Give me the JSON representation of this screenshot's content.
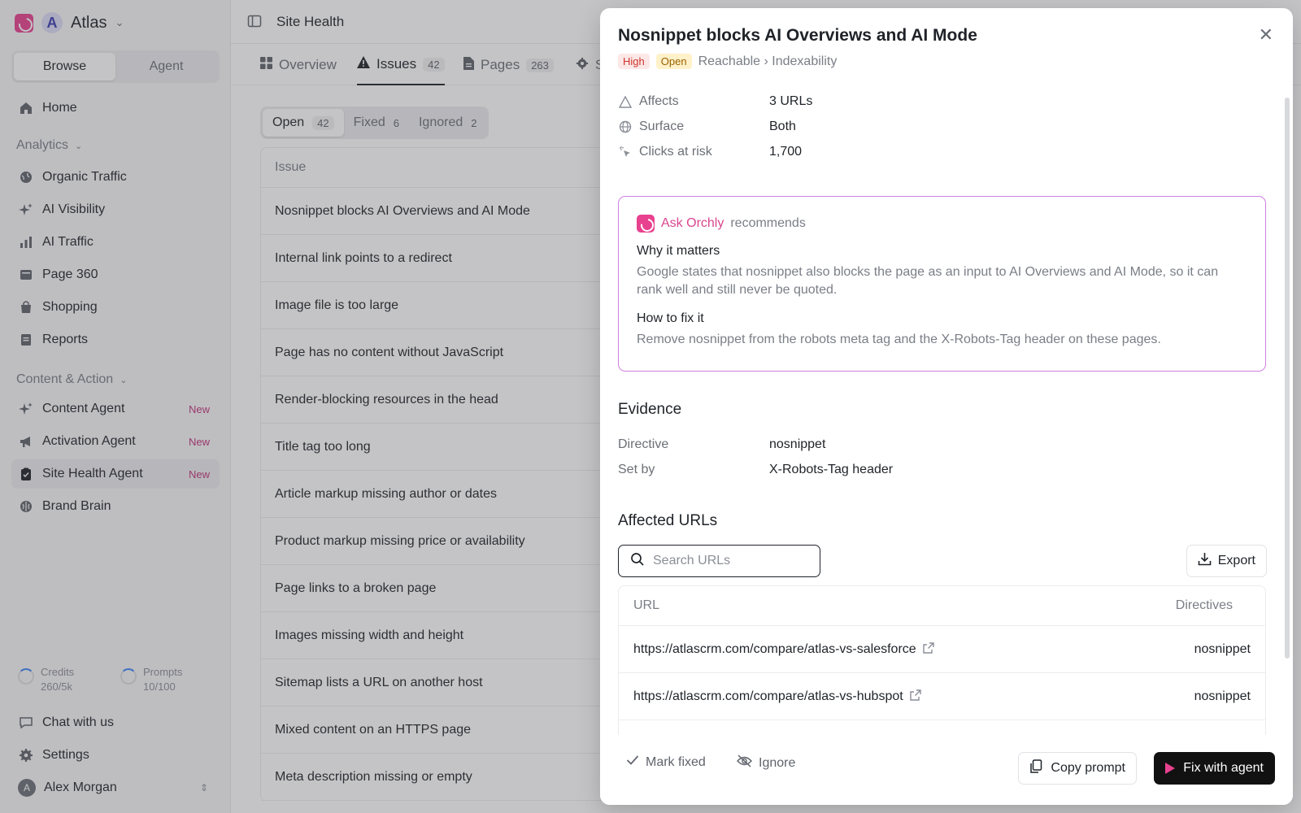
{
  "sidebar": {
    "workspace": {
      "initial": "A",
      "name": "Atlas"
    },
    "mode": {
      "browse": "Browse",
      "agent": "Agent"
    },
    "home": "Home",
    "analytics_label": "Analytics",
    "analytics": [
      "Organic Traffic",
      "AI Visibility",
      "AI Traffic",
      "Page 360",
      "Shopping",
      "Reports"
    ],
    "content_label": "Content & Action",
    "content": [
      {
        "label": "Content Agent",
        "badge": "New"
      },
      {
        "label": "Activation Agent",
        "badge": "New"
      },
      {
        "label": "Site Health Agent",
        "badge": "New"
      },
      {
        "label": "Brand Brain",
        "badge": ""
      }
    ],
    "credits": {
      "label": "Credits",
      "value": "260/5k"
    },
    "prompts": {
      "label": "Prompts",
      "value": "10/100"
    },
    "chat": "Chat with us",
    "settings": "Settings",
    "user": {
      "initial": "A",
      "name": "Alex Morgan"
    }
  },
  "main": {
    "title": "Site Health",
    "tabs": [
      {
        "label": "Overview",
        "count": ""
      },
      {
        "label": "Issues",
        "count": "42"
      },
      {
        "label": "Pages",
        "count": "263"
      },
      {
        "label": "S",
        "count": ""
      }
    ],
    "filters": [
      {
        "label": "Open",
        "count": "42"
      },
      {
        "label": "Fixed",
        "count": "6"
      },
      {
        "label": "Ignored",
        "count": "2"
      }
    ],
    "table_header": "Issue",
    "issues": [
      "Nosnippet blocks AI Overviews and AI Mode",
      "Internal link points to a redirect",
      "Image file is too large",
      "Page has no content without JavaScript",
      "Render-blocking resources in the head",
      "Title tag too long",
      "Article markup missing author or dates",
      "Product markup missing price or availability",
      "Page links to a broken page",
      "Images missing width and height",
      "Sitemap lists a URL on another host",
      "Mixed content on an HTTPS page",
      "Meta description missing or empty"
    ]
  },
  "drawer": {
    "title": "Nosnippet blocks AI Overviews and AI Mode",
    "severity": "High",
    "status": "Open",
    "breadcrumb": "Reachable › Indexability",
    "facts": [
      {
        "icon": "warning-icon",
        "key": "Affects",
        "value": "3 URLs"
      },
      {
        "icon": "globe-icon",
        "key": "Surface",
        "value": "Both"
      },
      {
        "icon": "click-icon",
        "key": "Clicks at risk",
        "value": "1,700"
      }
    ],
    "recommendation": {
      "ask": "Ask Orchly",
      "suffix": "recommends",
      "why_title": "Why it matters",
      "why_text": "Google states that nosnippet also blocks the page as an input to AI Overviews and AI Mode, so it can rank well and still never be quoted.",
      "fix_title": "How to fix it",
      "fix_text": "Remove nosnippet from the robots meta tag and the X-Robots-Tag header on these pages."
    },
    "evidence": {
      "title": "Evidence",
      "rows": [
        {
          "key": "Directive",
          "value": "nosnippet"
        },
        {
          "key": "Set by",
          "value": "X-Robots-Tag header"
        }
      ]
    },
    "affected": {
      "title": "Affected URLs",
      "search_placeholder": "Search URLs",
      "export": "Export",
      "col_url": "URL",
      "col_directives": "Directives",
      "rows": [
        {
          "url": "https://atlascrm.com/compare/atlas-vs-salesforce",
          "directive": "nosnippet"
        },
        {
          "url": "https://atlascrm.com/compare/atlas-vs-hubspot",
          "directive": "nosnippet"
        }
      ]
    },
    "actions": {
      "mark_fixed": "Mark fixed",
      "ignore": "Ignore",
      "copy_prompt": "Copy prompt",
      "fix_agent": "Fix with agent"
    }
  }
}
